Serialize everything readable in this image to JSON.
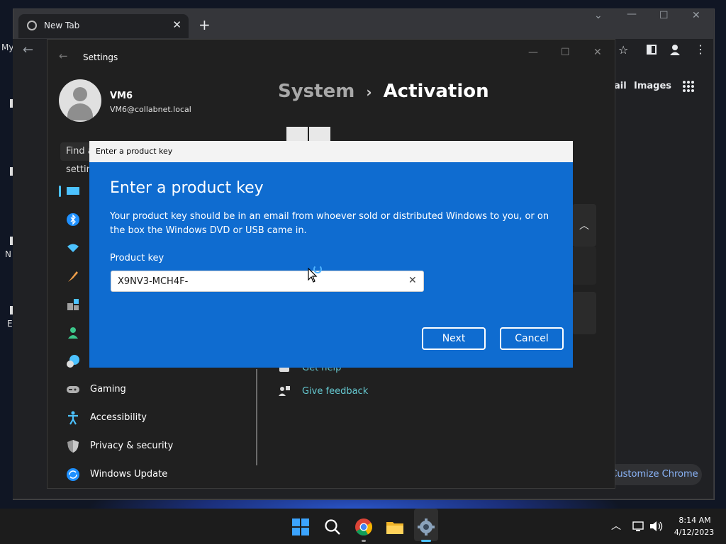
{
  "browser": {
    "tab_title": "New Tab",
    "tab_close": "✕",
    "new_tab": "+",
    "bookmark_label": "My",
    "header_links": [
      "ail",
      "Images"
    ],
    "customize_label": "Customize Chrome"
  },
  "settings": {
    "window_title": "Settings",
    "user": {
      "name": "VM6",
      "email": "VM6@collabnet.local"
    },
    "search_placeholder": "Find a setting",
    "breadcrumb": {
      "parent": "System",
      "separator": "›",
      "current": "Activation"
    },
    "nav": [
      {
        "label": "Gaming",
        "icon": "gamepad-icon"
      },
      {
        "label": "Accessibility",
        "icon": "accessibility-icon"
      },
      {
        "label": "Privacy & security",
        "icon": "shield-icon"
      },
      {
        "label": "Windows Update",
        "icon": "windows-update-icon"
      }
    ],
    "links": {
      "get_help": "Get help",
      "give_feedback": "Give feedback"
    }
  },
  "dialog": {
    "window_title": "Enter a product key",
    "heading": "Enter a product key",
    "description": "Your product key should be in an email from whoever sold or distributed Windows to you, or on the box the Windows DVD or USB came in.",
    "field_label": "Product key",
    "field_value": "X9NV3-MCH4F-",
    "clear_glyph": "✕",
    "next_label": "Next",
    "cancel_label": "Cancel"
  },
  "taskbar": {
    "time": "8:14 AM",
    "date": "4/12/2023"
  },
  "desktop": {
    "labels": [
      "N",
      "E"
    ]
  },
  "colors": {
    "dialog_blue": "#0f6cd0",
    "settings_bg": "#202020",
    "link_teal": "#65c8d0",
    "accent": "#4cc2ff"
  }
}
